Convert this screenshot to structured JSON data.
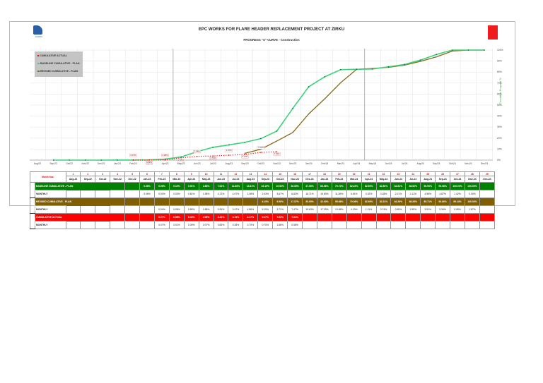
{
  "header": {
    "title": "EPC WORKS FOR FLARE HEADER REPLACEMENT PROJECT AT ZIRKU",
    "subtitle": "PROGRESS \"S\" CURVE -   Construction",
    "logo_text": "ADNOC"
  },
  "colors": {
    "baseline": "#008000",
    "revised": "#7f5f00",
    "actual": "#ff0000",
    "baseline_line": "#3dd17a",
    "revised_line": "#8a6a12"
  },
  "chart_data": {
    "type": "line",
    "title": "PROGRESS \"S\" CURVE - Construction",
    "ylabel": "Cumulative Progress %",
    "ylim": [
      0,
      100
    ],
    "y_ticks": [
      "0%",
      "10%",
      "20%",
      "30%",
      "40%",
      "50%",
      "60%",
      "70%",
      "80%",
      "90%",
      "100%"
    ],
    "grid": true,
    "legend_position": "top-left",
    "categories": [
      "Aug/22",
      "Sep/22",
      "Oct/22",
      "Nov/22",
      "Dec/22",
      "Jan/23",
      "Feb/23",
      "Mar/23",
      "Apr/23",
      "May/23",
      "Jun/23",
      "Jul/23",
      "Aug/23",
      "Sep/23",
      "Oct/23",
      "Nov/23",
      "Dec/23",
      "Jan/24",
      "Feb/24",
      "Mar/24",
      "Apr/24",
      "May/24",
      "Jun/24",
      "Jul/24",
      "Aug/24",
      "Sep/24",
      "Oct/24",
      "Nov/24",
      "Dec/24"
    ],
    "series": [
      {
        "name": "CUMULATIVE ACTUAL",
        "key": "actual",
        "values": [
          null,
          null,
          null,
          null,
          null,
          null,
          0.07,
          0.08,
          0.08,
          2.05,
          3.44,
          3.73,
          4.47,
          5.17,
          7.03,
          7.61,
          null,
          null,
          null,
          null,
          null,
          null,
          null,
          null,
          null,
          null,
          null,
          null,
          null
        ],
        "labels": [
          "",
          "",
          "",
          "",
          "",
          "",
          "0.07%",
          "0.08%",
          "0.08%",
          "2.05%",
          "3.44%",
          "3.73%",
          "4.47%",
          "5.17%",
          "7.03%",
          "7.61%",
          "",
          "",
          "",
          "",
          "",
          "",
          "",
          "",
          "",
          "",
          "",
          "",
          ""
        ]
      },
      {
        "name": "BASELINE CUMULATIVE - PLAN",
        "key": "baseline",
        "values": [
          null,
          0,
          0,
          0,
          0,
          0.06,
          0.06,
          0.1,
          0.91,
          2.88,
          7.61,
          11.68,
          13.81,
          16.19,
          19.52,
          26.35,
          47.06,
          66.66,
          75.72,
          82.22,
          82.56,
          82.8,
          84.81,
          86.92,
          90.9,
          95.98,
          100,
          100,
          100
        ]
      },
      {
        "name": "REVISED CUMULATIVE - PLAN",
        "key": "revised",
        "values": [
          null,
          null,
          null,
          null,
          null,
          null,
          null,
          null,
          null,
          null,
          null,
          null,
          null,
          6.19,
          9.9,
          17.37,
          25.09,
          42.0,
          55.68,
          70.36,
          82.56,
          83.31,
          84.29,
          86.29,
          89.71,
          93.8,
          99.13,
          100,
          100
        ]
      }
    ]
  },
  "legend": [
    "CUMULATIVE ACTUAL",
    "BASELINE CUMULATIVE - PLAN",
    "REVISED CUMULATIVE - PLAN"
  ],
  "table": {
    "month_nos_label": "Month Nos.",
    "month_numbers": [
      "1",
      "2",
      "3",
      "4",
      "5",
      "6",
      "7",
      "8",
      "9",
      "10",
      "11",
      "12",
      "13",
      "14",
      "15",
      "16",
      "17",
      "18",
      "19",
      "20",
      "21",
      "22",
      "23",
      "24",
      "25",
      "26",
      "27",
      "28",
      "29"
    ],
    "months": [
      "Aug-22",
      "Sep-22",
      "Oct-22",
      "Nov-22",
      "Dec-22",
      "Jan-23",
      "Feb-23",
      "Mar-23",
      "Apr-23",
      "May-23",
      "Jun-23",
      "Jul-23",
      "Aug-23",
      "Sep-23",
      "Oct-23",
      "Nov-23",
      "Dec-23",
      "Jan-24",
      "Feb-24",
      "Mar-24",
      "Apr-24",
      "May-24",
      "Jun-24",
      "Jul-24",
      "Aug-24",
      "Sep-24",
      "Oct-24",
      "Nov-24",
      "Dec-24"
    ],
    "groups": [
      {
        "side": "BASELINE",
        "key": "baseline",
        "rows": [
          {
            "label": "BASELINE CUMULATIVE - PLAN",
            "values": [
              "",
              "",
              "",
              "",
              "",
              "0.06%",
              "0.06%",
              "0.10%",
              "0.91%",
              "2.88%",
              "7.61%",
              "11.68%",
              "13.81%",
              "16.19%",
              "19.52%",
              "26.35%",
              "47.06%",
              "66.66%",
              "75.72%",
              "82.22%",
              "82.56%",
              "82.80%",
              "84.81%",
              "86.92%",
              "90.90%",
              "95.98%",
              "100.00%",
              "100.00%",
              ""
            ]
          },
          {
            "label": "MONTHLY",
            "values": [
              "",
              "",
              "",
              "",
              "",
              "0.06%",
              "0.00%",
              "0.03%",
              "0.81%",
              "1.98%",
              "4.72%",
              "4.07%",
              "2.08%",
              "2.03%",
              "3.67%",
              "6.83%",
              "16.71%",
              "19.60%",
              "11.06%",
              "6.51%",
              "0.32%",
              "0.28%",
              "2.01%",
              "2.11%",
              "4.98%",
              "4.87%",
              "1.42%",
              "0.00%",
              ""
            ]
          }
        ]
      },
      {
        "side": "REVISED",
        "key": "revised",
        "rows": [
          {
            "label": "REVISED CUMULATIVE - PLAN",
            "values": [
              "",
              "",
              "",
              "",
              "",
              "",
              "",
              "",
              "",
              "",
              "",
              "",
              "",
              "6.19%",
              "9.90%",
              "17.37%",
              "25.09%",
              "42.00%",
              "55.68%",
              "70.36%",
              "82.56%",
              "83.31%",
              "84.29%",
              "86.29%",
              "89.71%",
              "93.80%",
              "99.13%",
              "100.00%",
              ""
            ]
          },
          {
            "label": "MONTHLY",
            "values": [
              "",
              "",
              "",
              "",
              "",
              "",
              "0.04%",
              "0.06%",
              "0.80%",
              "1.88%",
              "0.26%",
              "3.47%",
              "4.86%",
              "5.19%",
              "3.71%",
              "7.47%",
              "19.63%",
              "17.29%",
              "13.68%",
              "4.19%",
              "1.11%",
              "0.74%",
              "0.98%",
              "1.59%",
              "3.51%",
              "5.34%",
              "5.08%",
              "1.87%",
              ""
            ]
          }
        ]
      },
      {
        "side": "ACTUAL",
        "key": "actual",
        "rows": [
          {
            "label": "CUMULATIVE ACTUAL",
            "values": [
              "",
              "",
              "",
              "",
              "",
              "",
              "0.07%",
              "0.08%",
              "0.08%",
              "2.05%",
              "3.44%",
              "3.73%",
              "4.47%",
              "5.17%",
              "7.03%",
              "7.61%",
              "",
              "",
              "",
              "",
              "",
              "",
              "",
              "",
              "",
              "",
              "",
              "",
              ""
            ]
          },
          {
            "label": "MONTHLY",
            "values": [
              "",
              "",
              "",
              "",
              "",
              "",
              "0.07%",
              "0.01%",
              "0.00%",
              "2.07%",
              "0.83%",
              "0.28%",
              "0.70%",
              "0.70%",
              "1.86%",
              "0.58%",
              "",
              "",
              "",
              "",
              "",
              "",
              "",
              "",
              "",
              "",
              "",
              "",
              ""
            ]
          }
        ]
      }
    ]
  }
}
